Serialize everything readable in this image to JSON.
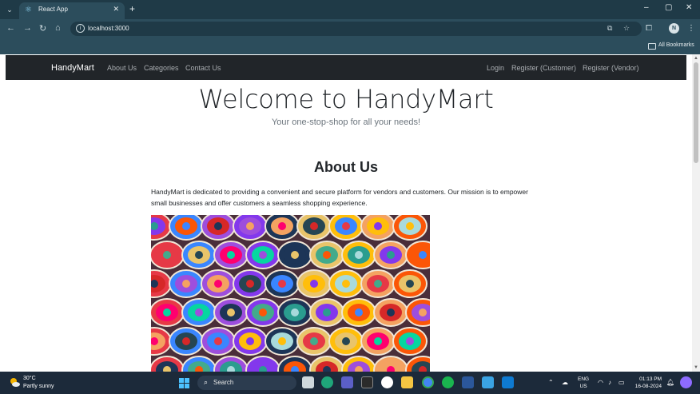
{
  "browser": {
    "tab_title": "React App",
    "new_tab_glyph": "+",
    "close_glyph": "✕",
    "url": "localhost:3000",
    "bookmarks_label": "All Bookmarks",
    "profile_initial": "N",
    "window_controls": {
      "minimize": "–",
      "maximize": "▢",
      "close": "✕"
    },
    "nav": {
      "back": "←",
      "forward": "→",
      "reload": "↻",
      "home": "⌂"
    }
  },
  "site": {
    "brand": "HandyMart",
    "nav_left": [
      "About Us",
      "Categories",
      "Contact Us"
    ],
    "nav_right": [
      "Login",
      "Register (Customer)",
      "Register (Vendor)"
    ],
    "hero_title": "Welcome to HandyMart",
    "hero_subtitle": "Your one-stop-shop for all your needs!",
    "about_title": "About Us",
    "about_text": "HandyMart is dedicated to providing a convenient and secure platform for vendors and customers. Our mission is to empower small businesses and offer customers a seamless shopping experience."
  },
  "taskbar": {
    "weather_temp": "30°C",
    "weather_desc": "Partly sunny",
    "search_placeholder": "Search",
    "lang_line1": "ENG",
    "lang_line2": "US",
    "time": "01:13 PM",
    "date": "16-08-2024"
  },
  "colors": {
    "chrome_dark": "#1f3a47",
    "chrome": "#2c4d5c",
    "navbar": "#212529",
    "taskbar": "#1c2a3a"
  }
}
